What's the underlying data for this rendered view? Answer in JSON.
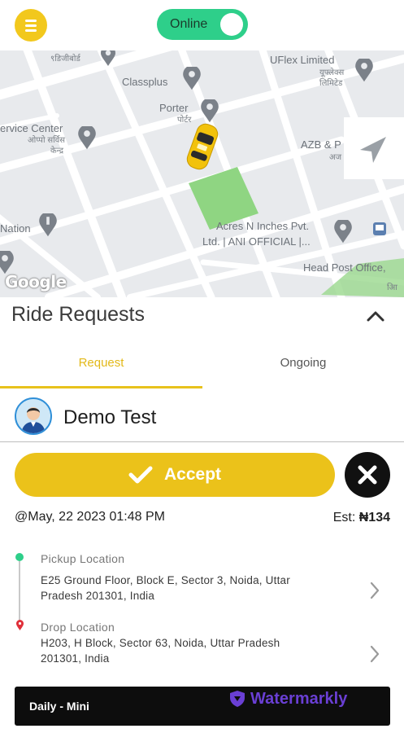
{
  "header": {
    "menu_icon": "menu-icon",
    "status_label": "Online",
    "status_on": true,
    "accent_color": "#f2c81d",
    "online_color": "#2ecf8a"
  },
  "map": {
    "pois": [
      {
        "label": "९डिजीबोर्ड"
      },
      {
        "label": "UFlex Limited"
      },
      {
        "label": "यूफ्लेक्स"
      },
      {
        "label": "लिमिटेड"
      },
      {
        "label": "Classplus"
      },
      {
        "label": "Porter"
      },
      {
        "label": "पोर्टर"
      },
      {
        "label": "ervice Center"
      },
      {
        "label": "ओप्पो सर्विस"
      },
      {
        "label": "केन्द्र"
      },
      {
        "label": "AZB & P"
      },
      {
        "label": "अज"
      },
      {
        "label": "Nation"
      },
      {
        "label": "Acres N Inches Pvt."
      },
      {
        "label": "Ltd. | ANI OFFICIAL |..."
      },
      {
        "label": "Head Post Office,"
      },
      {
        "label": "आि"
      }
    ],
    "attribution": "Google",
    "recenter_icon": "navigation-arrow-icon",
    "vehicle_icon": "taxi-car-icon"
  },
  "panel": {
    "title": "Ride Requests",
    "collapse_icon": "chevron-up-icon",
    "tabs": [
      {
        "label": "Request",
        "active": true
      },
      {
        "label": "Ongoing",
        "active": false
      }
    ]
  },
  "request": {
    "rider_name": "Demo Test",
    "avatar_icon": "user-avatar-icon",
    "accept_label": "Accept",
    "accept_icon": "check-icon",
    "reject_icon": "close-icon",
    "datetime": "@May, 22 2023 01:48 PM",
    "est_label": "Est:",
    "est_value": "₦134",
    "pickup": {
      "label": "Pickup Location",
      "address_line1": "E25 Ground Floor, Block E, Sector 3, Noida, Uttar",
      "address_line2": "Pradesh 201301, India"
    },
    "drop": {
      "label": "Drop Location",
      "address_line1": "H203, H Block, Sector 63, Noida, Uttar Pradesh",
      "address_line2": "201301, India"
    },
    "vehicle_type": "Daily - Mini",
    "watermark": "Watermarkly"
  }
}
